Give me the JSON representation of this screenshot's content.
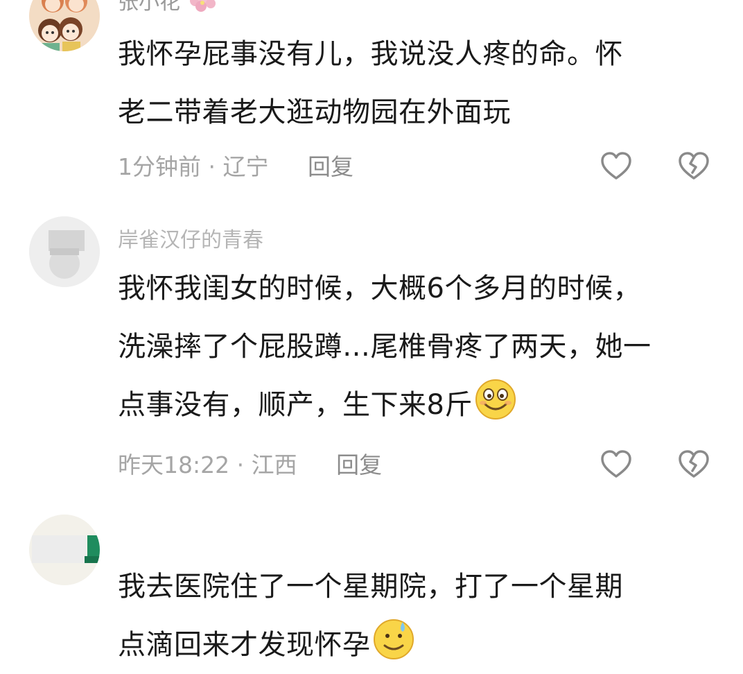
{
  "comments": [
    {
      "username": "张小花",
      "username_emoji": "flower-emoji",
      "lines": [
        "我怀孕屁事没有儿，我说没人疼的命。怀",
        "老二带着老大逛动物园在外面玩"
      ],
      "time": "1分钟前",
      "separator": "·",
      "location": "辽宁",
      "reply_label": "回复"
    },
    {
      "username": "岸雀汉仔的青春",
      "lines": [
        "我怀我闺女的时候，大概6个多月的时候，",
        "洗澡摔了个屁股蹲…尾椎骨疼了两天，她一",
        "点事没有，顺产，生下来8斤"
      ],
      "trailing_emoji": "smiling-face-emoji",
      "time": "昨天18:22",
      "separator": "·",
      "location": "江西",
      "reply_label": "回复"
    },
    {
      "username": "",
      "lines": [
        "我去医院住了一个星期院，打了一个星期",
        "点滴回来才发现怀孕"
      ],
      "trailing_emoji": "sweat-smile-emoji"
    }
  ],
  "colors": {
    "text": "#1a1a1a",
    "meta": "#a5a5a5",
    "icon_stroke": "#8a8a8a"
  }
}
